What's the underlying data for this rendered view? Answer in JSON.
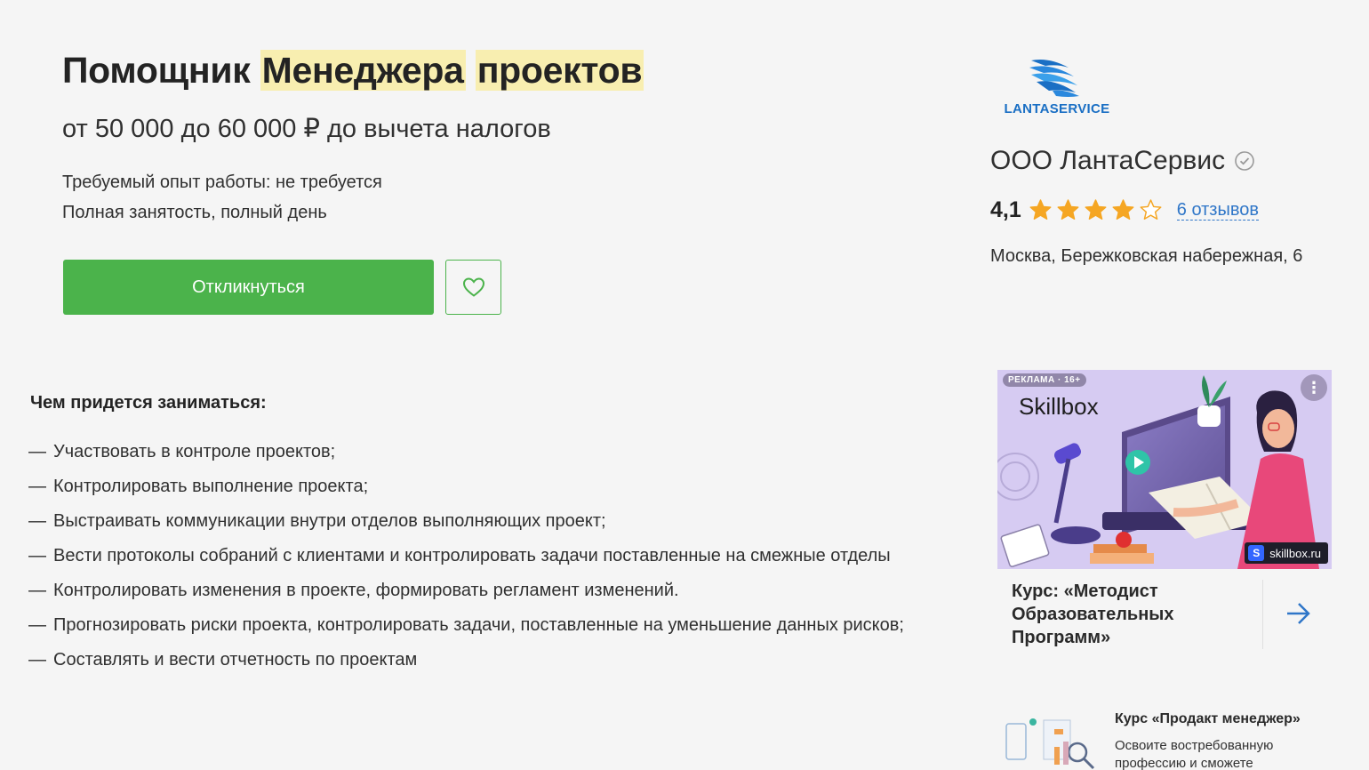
{
  "vacancy": {
    "title_part1": "Помощник ",
    "title_part2": "Менеджера",
    "title_part3": "проектов",
    "salary": "от 50 000 до 60 000 ₽ до вычета налогов",
    "experience": "Требуемый опыт работы: не требуется",
    "employment": "Полная занятость, полный день",
    "apply_label": "Откликнуться"
  },
  "description": {
    "section_title": "Чем придется заниматься:",
    "tasks": [
      "Участвовать в контроле проектов;",
      "Контролировать выполнение проекта;",
      "Выстраивать коммуникации внутри отделов выполняющих проект;",
      "Вести протоколы собраний с клиентами и контролировать задачи поставленные на смежные отделы",
      "Контролировать изменения в проекте, формировать регламент изменений.",
      "Прогнозировать риски проекта, контролировать задачи, поставленные на уменьшение данных рисков;",
      "Составлять и вести отчетность по проектам"
    ]
  },
  "employer": {
    "logo_text": "LANTASERVICE",
    "name": "ООО ЛантаСервис",
    "rating": "4,1",
    "rating_value": 4.1,
    "rating_max": 5,
    "reviews": "6 отзывов",
    "address": "Москва, Бережковская набережная, 6"
  },
  "ad": {
    "badge": "РЕКЛАМА · 16+",
    "brand": "Skillbox",
    "site": "skillbox.ru",
    "site_mark": "S",
    "caption": "Курс: «Методист Образовательных Программ»"
  },
  "ad2": {
    "title": "Курс «Продакт менеджер»",
    "text": "Освоите востребованную профессию и сможете"
  },
  "colors": {
    "accent_green": "#4bb34b",
    "link_blue": "#2f76c8",
    "star": "#f5a623",
    "highlight": "#f8eeb0"
  },
  "icons": {
    "favorite": "heart-icon",
    "verified": "check-circle-icon",
    "next": "arrow-right-icon",
    "more": "more-dots-icon"
  }
}
